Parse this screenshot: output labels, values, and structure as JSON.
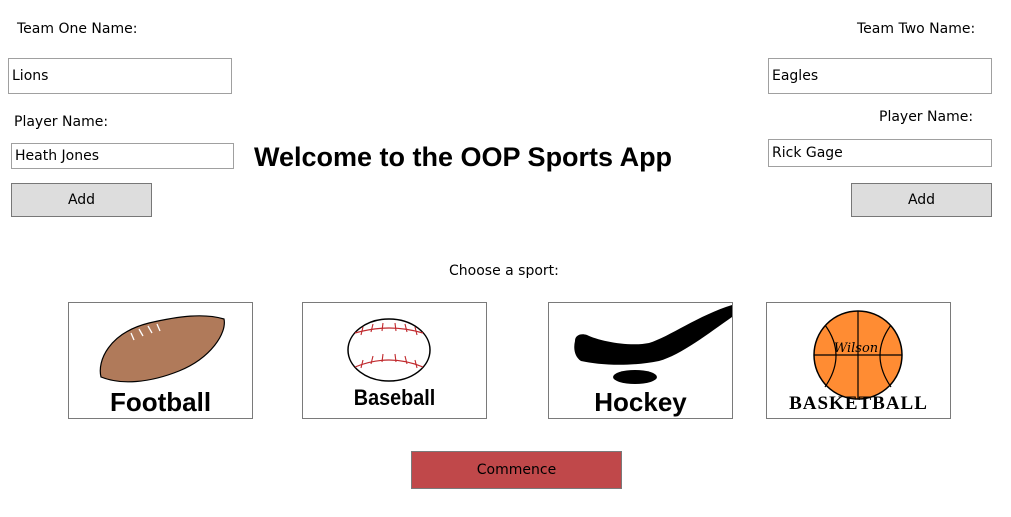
{
  "team_one": {
    "name_label": "Team One Name:",
    "name_value": "Lions",
    "player_label": "Player Name:",
    "player_value": "Heath Jones",
    "add_label": "Add"
  },
  "team_two": {
    "name_label": "Team Two Name:",
    "name_value": "Eagles",
    "player_label": "Player Name:",
    "player_value": "Rick Gage",
    "add_label": "Add"
  },
  "title": "Welcome to the OOP Sports App",
  "choose_label": "Choose a sport:",
  "sports": [
    {
      "caption": "Football",
      "icon": "football-icon"
    },
    {
      "caption": "Baseball",
      "icon": "baseball-icon"
    },
    {
      "caption": "Hockey",
      "icon": "hockey-icon"
    },
    {
      "caption": "BASKETBALL",
      "icon": "basketball-icon"
    }
  ],
  "basketball_brand": "Wilson",
  "commence_label": "Commence",
  "colors": {
    "commence_bg": "#c0484a",
    "button_bg": "#dddddd",
    "football": "#b07a5a",
    "basketball": "#ff8c33",
    "baseball_stitch": "#c0282c"
  }
}
